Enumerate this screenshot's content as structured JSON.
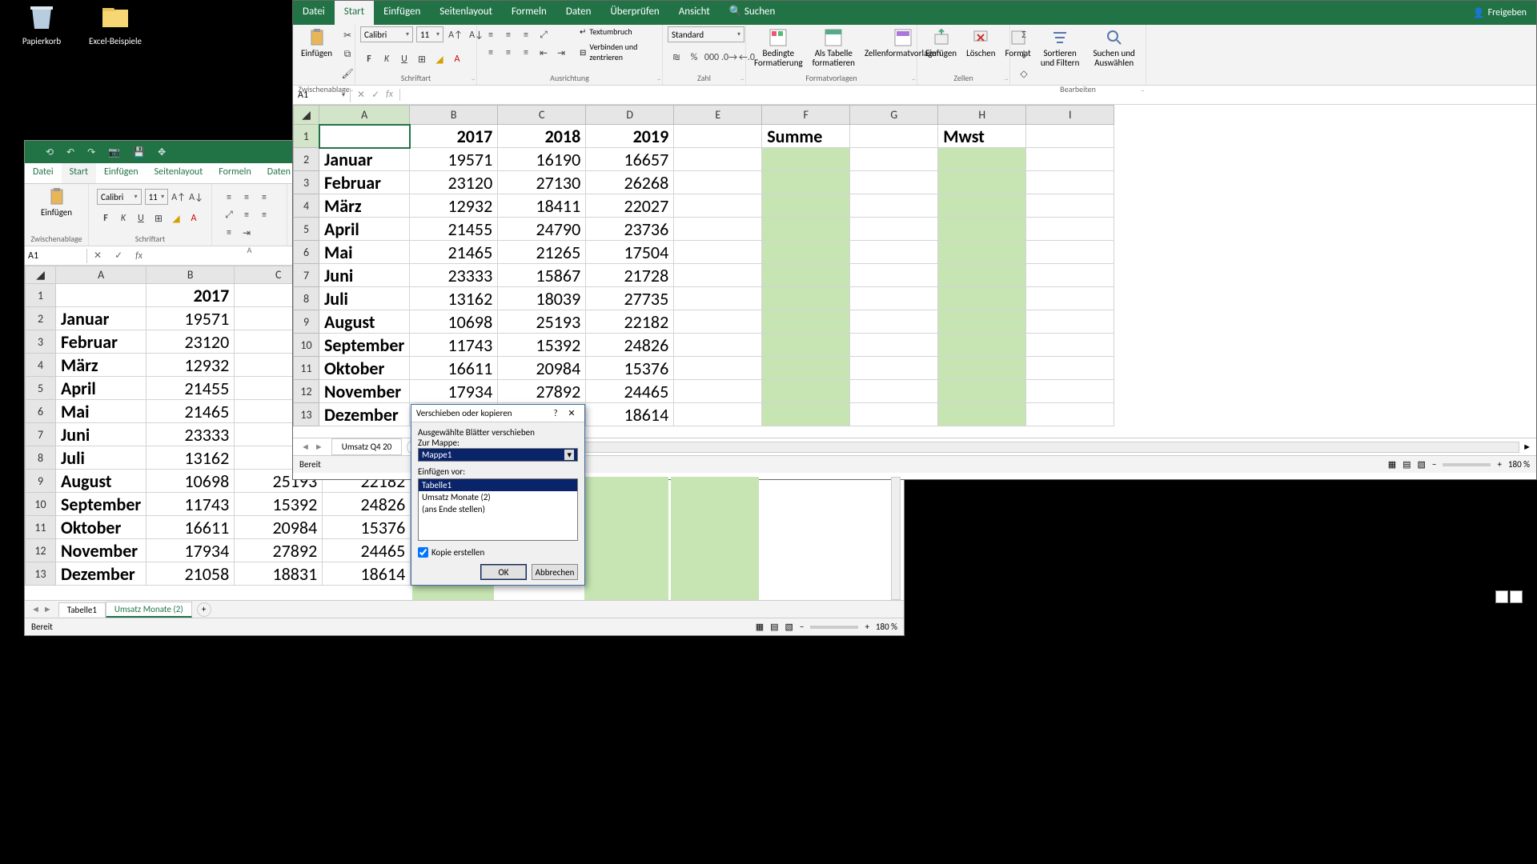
{
  "desktop": {
    "papierkorb": "Papierkorb",
    "excel_beispiele": "Excel-Beispiele"
  },
  "tabs": {
    "datei": "Datei",
    "start": "Start",
    "einfuegen": "Einfügen",
    "seitenlayout": "Seitenlayout",
    "formeln": "Formeln",
    "daten": "Daten",
    "ueberpruefen": "Überprüfen",
    "ansicht": "Ansicht",
    "suchen_ph": "Suchen",
    "freigeben": "Freigeben"
  },
  "ribbon": {
    "einfuegen": "Einfügen",
    "zwischenablage": "Zwischenablage",
    "font_name": "Calibri",
    "font_size": "11",
    "schriftart": "Schriftart",
    "ausrichtung": "Ausrichtung",
    "textumbruch": "Textumbruch",
    "verbinden": "Verbinden und zentrieren",
    "zahl": "Zahl",
    "standard": "Standard",
    "bedingte": "Bedingte Formatierung",
    "alstabelle": "Als Tabelle formatieren",
    "zellfmt": "Zellenformatvorlagen",
    "formatvorlagen": "Formatvorlagen",
    "insert": "Einfügen",
    "delete": "Löschen",
    "format": "Format",
    "zellen": "Zellen",
    "sort": "Sortieren und Filtern",
    "find": "Suchen und Auswählen",
    "bearbeiten": "Bearbeiten"
  },
  "namebox": "A1",
  "headers": {
    "b": "2017",
    "c": "2018",
    "d": "2019",
    "f": "Summe",
    "h": "Mwst"
  },
  "months": [
    "Januar",
    "Februar",
    "März",
    "April",
    "Mai",
    "Juni",
    "Juli",
    "August",
    "September",
    "Oktober",
    "November",
    "Dezember"
  ],
  "data": {
    "2017": [
      19571,
      23120,
      12932,
      21455,
      21465,
      23333,
      13162,
      10698,
      11743,
      16611,
      17934,
      21058
    ],
    "2018": [
      16190,
      27130,
      18411,
      24790,
      21265,
      15867,
      18039,
      25193,
      15392,
      20984,
      27892,
      18831
    ],
    "2019": [
      16657,
      26268,
      22027,
      23736,
      17504,
      21728,
      27735,
      22182,
      24826,
      15376,
      24465,
      18614
    ]
  },
  "sheet_front": "Umsatz Q4 20",
  "sheet_back_1": "Tabelle1",
  "sheet_back_2": "Umsatz Monate (2)",
  "status": "Bereit",
  "zoom": "180 %",
  "zoom_back": "180 %",
  "dialog": {
    "title": "Verschieben oder kopieren",
    "line1": "Ausgewählte Blätter verschieben",
    "line2": "Zur Mappe:",
    "mappe": "Mappe1",
    "einfuegen_vor": "Einfügen vor:",
    "opt1": "Tabelle1",
    "opt2": "Umsatz Monate (2)",
    "opt3": "(ans Ende stellen)",
    "kopie": "Kopie erstellen",
    "ok": "OK",
    "cancel": "Abbrechen"
  }
}
